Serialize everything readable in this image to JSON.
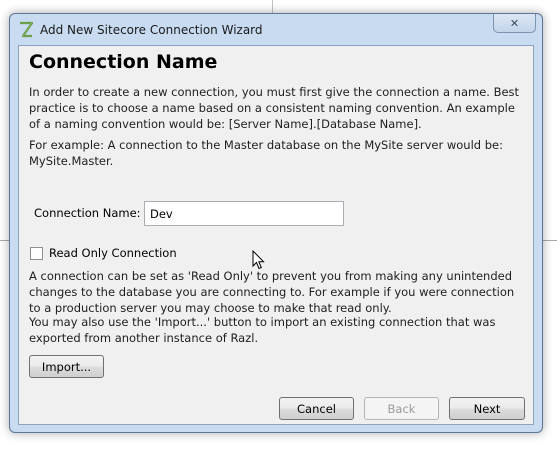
{
  "window": {
    "title": "Add New Sitecore Connection Wizard",
    "close_label": "✕"
  },
  "page": {
    "heading": "Connection Name",
    "intro_text": "In order to create a new connection, you must first give the connection a name. Best practice is to choose a name based on a consistent naming convention. An example of a naming convention would be: [Server Name].[Database Name].",
    "example_text": "For example: A connection to the Master database on the MySite server would be: MySite.Master."
  },
  "form": {
    "connection_name_label": "Connection Name:",
    "connection_name_value": "Dev",
    "read_only_label": "Read Only Connection",
    "read_only_checked": false
  },
  "info": {
    "read_only_text": "A connection can be set as 'Read Only' to prevent you from making any unintended changes to the database you are connecting to. For example if you were connection to a production server you may choose to make that read only.",
    "import_text": "You may also use the 'Import...' button to import an existing connection that was exported from another instance of Razl."
  },
  "buttons": {
    "import_label": "Import...",
    "cancel_label": "Cancel",
    "back_label": "Back",
    "next_label": "Next"
  }
}
